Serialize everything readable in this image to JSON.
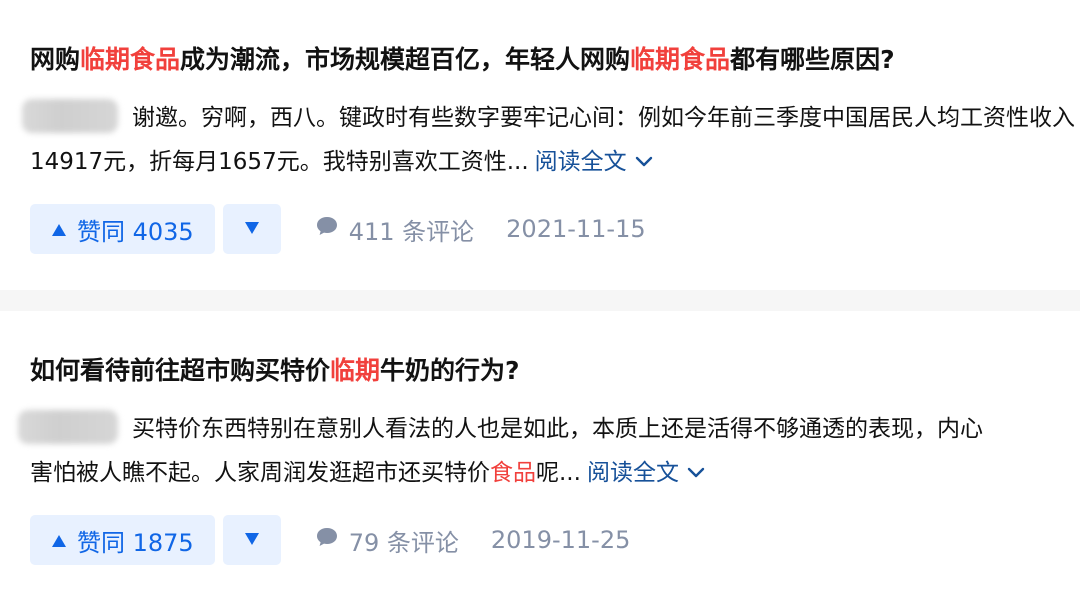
{
  "colors": {
    "highlight": "#f1403c",
    "link": "#175199",
    "vote_bg": "#e8f1ff",
    "vote_fg": "#1066e6",
    "meta": "#8590a6",
    "separator": "#f6f6f6"
  },
  "answers": [
    {
      "title_parts": [
        "网购",
        "临期食品",
        "成为潮流，市场规模超百亿，年轻人网购",
        "临期食品",
        "都有哪些原因?"
      ],
      "excerpt_line1": "谢邀。穷啊，西八。键政时有些数字要牢记心间：例如今年前三季度中国居民人均工资性收入",
      "excerpt_line2": "14917元，折每月1657元。我特别喜欢工资性...",
      "read_more": "阅读全文",
      "upvote_label": "赞同 4035",
      "comments_label": "411 条评论",
      "date": "2021-11-15",
      "icons": {
        "upvote": "triangle-up-icon",
        "downvote": "triangle-down-icon",
        "comment": "comment-bubble-icon",
        "expand": "chevron-down-icon",
        "avatar": "blurred-avatar"
      }
    },
    {
      "title_parts": [
        "如何看待前往超市购买特价",
        "临期",
        "牛奶的行为?"
      ],
      "excerpt_line1": "买特价东西特别在意别人看法的人也是如此，本质上还是活得不够通透的表现，内心",
      "excerpt_line2_parts": [
        "害怕被人瞧不起。人家周润发逛超市还买特价",
        "食品",
        "呢..."
      ],
      "read_more": "阅读全文",
      "upvote_label": "赞同 1875",
      "comments_label": "79 条评论",
      "date": "2019-11-25",
      "icons": {
        "upvote": "triangle-up-icon",
        "downvote": "triangle-down-icon",
        "comment": "comment-bubble-icon",
        "expand": "chevron-down-icon",
        "avatar": "blurred-avatar"
      }
    }
  ]
}
